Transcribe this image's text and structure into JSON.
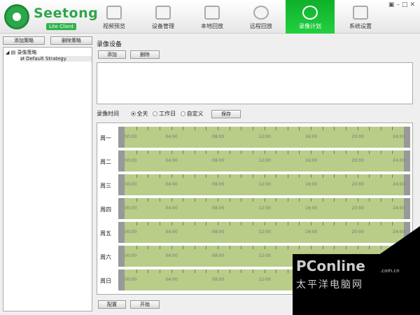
{
  "app": {
    "name": "Seetong",
    "subtitle": "Lite Client"
  },
  "tabs": [
    {
      "label": "视频预览"
    },
    {
      "label": "设备管理"
    },
    {
      "label": "本地回放"
    },
    {
      "label": "远程回放"
    },
    {
      "label": "录像计划",
      "active": true
    },
    {
      "label": "系统设置"
    }
  ],
  "left": {
    "add_label": "添加策略",
    "delete_label": "删除策略",
    "tree_root": "录像策略",
    "tree_child": "Default Strategy"
  },
  "right": {
    "title": "录像设备",
    "add_label": "添加",
    "delete_label": "删除",
    "time_label": "录像时间",
    "options": [
      "全天",
      "工作日",
      "自定义"
    ],
    "selected": "全天",
    "save_label": "保存",
    "days": [
      "周一",
      "周二",
      "周三",
      "周四",
      "周五",
      "周六",
      "周日"
    ],
    "hour_labels": [
      "00:00",
      "04:00",
      "08:00",
      "12:00",
      "16:00",
      "20:00",
      "24:00"
    ],
    "config_label": "配置",
    "start_label": "开始"
  },
  "watermark": {
    "brand": "PConline",
    "domain": ".com.cn",
    "cn": "太平洋电脑网"
  },
  "colors": {
    "active_tab": "#1cc63a",
    "timeline": "#b9cc88"
  }
}
